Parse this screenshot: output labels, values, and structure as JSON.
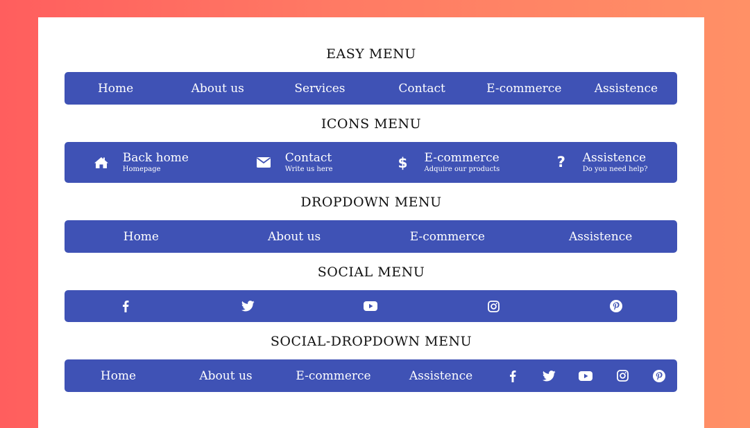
{
  "sections": {
    "easy": {
      "title": "EASY MENU",
      "items": [
        "Home",
        "About us",
        "Services",
        "Contact",
        "E-commerce",
        "Assistence"
      ]
    },
    "icons": {
      "title": "ICONS MENU",
      "items": [
        {
          "label": "Back home",
          "sub": "Homepage",
          "icon": "home-icon"
        },
        {
          "label": "Contact",
          "sub": "Write us here",
          "icon": "envelope-icon"
        },
        {
          "label": "E-commerce",
          "sub": "Adquire our products",
          "icon": "dollar-icon"
        },
        {
          "label": "Assistence",
          "sub": "Do you need help?",
          "icon": "question-icon"
        }
      ]
    },
    "dropdown": {
      "title": "DROPDOWN MENU",
      "items": [
        "Home",
        "About us",
        "E-commerce",
        "Assistence"
      ]
    },
    "social": {
      "title": "SOCIAL MENU",
      "icons": [
        "facebook-icon",
        "twitter-icon",
        "youtube-icon",
        "instagram-icon",
        "pinterest-icon"
      ]
    },
    "social_dropdown": {
      "title": "SOCIAL-DROPDOWN MENU",
      "items": [
        "Home",
        "About us",
        "E-commerce",
        "Assistence"
      ],
      "icons": [
        "facebook-icon",
        "twitter-icon",
        "youtube-icon",
        "instagram-icon",
        "pinterest-icon"
      ]
    }
  },
  "colors": {
    "bar": "#3f52b5",
    "background_left": "#ff5e5e",
    "background_right": "#ff9066"
  }
}
